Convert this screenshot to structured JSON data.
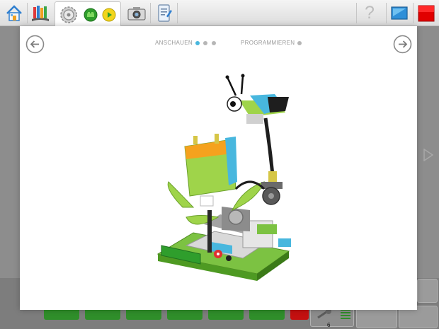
{
  "toolbar": {
    "items": [
      {
        "name": "home-button",
        "icon": "home-icon"
      },
      {
        "name": "projects-button",
        "icon": "book-icon"
      },
      {
        "name": "program-tab",
        "icon": "gear-icon"
      },
      {
        "name": "camera-button",
        "icon": "camera-icon"
      },
      {
        "name": "document-button",
        "icon": "document-icon"
      },
      {
        "name": "help-button",
        "icon": "help-icon",
        "glyph": "?"
      },
      {
        "name": "display-button",
        "icon": "display-icon"
      },
      {
        "name": "stop-button",
        "icon": "stop-icon"
      }
    ]
  },
  "modal": {
    "steps": [
      {
        "label": "ANSCHAUEN",
        "dots": 3,
        "active_dot": 0
      },
      {
        "label": "PROGRAMMIEREN",
        "dots": 1,
        "active_dot": -1
      }
    ],
    "prev_icon": "arrow-left-icon",
    "next_icon": "arrow-right-icon"
  },
  "bottom": {
    "sensor_count": "6"
  },
  "colors": {
    "accent": "#48b7de",
    "stop": "#e10000",
    "block_green": "#2f9e2c"
  }
}
